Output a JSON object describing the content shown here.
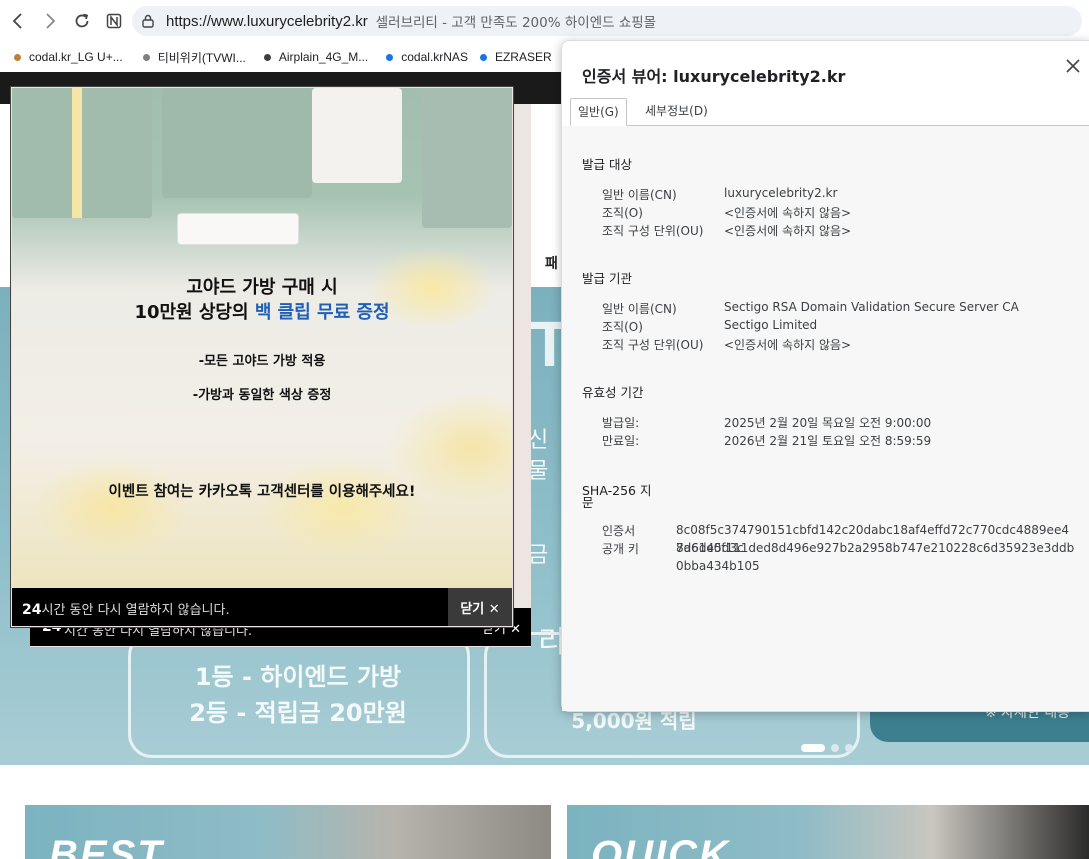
{
  "browser": {
    "url": "https://www.luxurycelebrity2.kr",
    "page_title": "셀러브리티 - 고객 만족도 200% 하이엔드 쇼핑몰",
    "bookmarks": [
      {
        "label": "codal.kr_LG U+...",
        "color": "#c0803a"
      },
      {
        "label": "티비위키(TVWI...",
        "color": "#808080"
      },
      {
        "label": "Airplain_4G_M...",
        "color": "#404040"
      },
      {
        "label": "codal.krNAS",
        "color": "#1a73e8"
      },
      {
        "label": "EZRASER",
        "color": "#1a73e8"
      }
    ]
  },
  "site": {
    "nav_partial": "패",
    "hero_big": "TV",
    "hero_side_1": "신 ",
    "hero_side_2": "물",
    "hero_side_3": "금",
    "hero_side_4": "리",
    "prize_1": "1등 - 하이엔드 가방",
    "prize_2": "2등 - 적립금 20만원",
    "prize_3": "5,000원 적립",
    "details_btn": "※ 자세한 내용",
    "promo_left": "BEST",
    "promo_right": "QUICK"
  },
  "popup": {
    "line1": "고야드 가방 구매 시",
    "line2_pre": "10만원 상당의 ",
    "line2_highlight": "백 클립 무료 증정",
    "bullet1": "-모든 고야드 가방 적용",
    "bullet2": "-가방과 동일한 색상 증정",
    "event": "이벤트 참여는 카카오톡 고객센터를 이용해주세요!",
    "footer_bold": "24",
    "footer_text": "시간 동안 다시 열람하지 않습니다.",
    "close_label": "닫기 ✕"
  },
  "cert": {
    "title": "인증서 뷰어: luxurycelebrity2.kr",
    "tabs": [
      "일반(G)",
      "세부정보(D)"
    ],
    "issued_to": {
      "heading": "발급 대상",
      "rows": [
        {
          "label": "일반 이름(CN)",
          "value": "luxurycelebrity2.kr"
        },
        {
          "label": "조직(O)",
          "value": "<인증서에 속하지 않음>"
        },
        {
          "label": "조직 구성 단위(OU)",
          "value": "<인증서에 속하지 않음>"
        }
      ]
    },
    "issued_by": {
      "heading": "발급 기관",
      "rows": [
        {
          "label": "일반 이름(CN)",
          "value": "Sectigo RSA Domain Validation Secure Server CA"
        },
        {
          "label": "조직(O)",
          "value": "Sectigo Limited"
        },
        {
          "label": "조직 구성 단위(OU)",
          "value": "<인증서에 속하지 않음>"
        }
      ]
    },
    "validity": {
      "heading": "유효성 기간",
      "rows": [
        {
          "label": "발급일:",
          "value": "2025년 2월 20일 목요일 오전 9:00:00"
        },
        {
          "label": "만료일:",
          "value": "2026년 2월 21일 토요일 오전 8:59:59"
        }
      ]
    },
    "fingerprints": {
      "heading_1": "SHA-256 지",
      "heading_2": "문",
      "rows": [
        {
          "label": "인증서",
          "value": "8c08f5c374790151cbfd142c20dabc18af4effd72c770cdc4889ee48d6d45d3c"
        },
        {
          "label": "공개 키",
          "value": "7a61e0f111ded8d496e927b2a2958b747e210228c6d35923e3ddb0bba434b105"
        }
      ]
    }
  }
}
